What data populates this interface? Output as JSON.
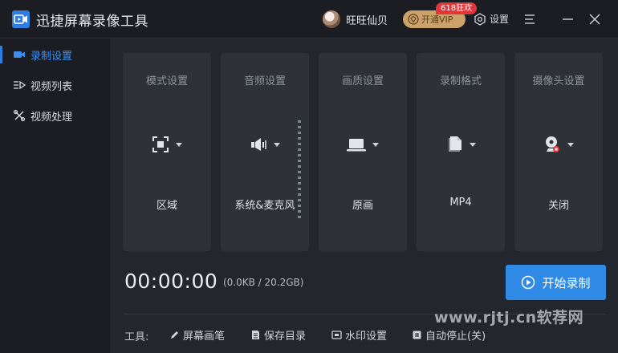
{
  "app": {
    "title": "迅捷屏幕录像工具",
    "logo_icon": "video-camera-icon"
  },
  "header": {
    "username": "旺旺仙贝",
    "vip_label": "开通VIP",
    "promo_badge": "618狂欢",
    "settings_label": "设置"
  },
  "sidebar": {
    "items": [
      {
        "label": "录制设置",
        "icon": "camera-icon",
        "active": true
      },
      {
        "label": "视频列表",
        "icon": "list-icon",
        "active": false
      },
      {
        "label": "视频处理",
        "icon": "tools-icon",
        "active": false
      }
    ]
  },
  "cards": [
    {
      "title": "模式设置",
      "value": "区域",
      "icon": "region-select-icon"
    },
    {
      "title": "音频设置",
      "value": "系统&麦克风",
      "icon": "speaker-icon"
    },
    {
      "title": "画质设置",
      "value": "原画",
      "icon": "laptop-icon"
    },
    {
      "title": "录制格式",
      "value": "MP4",
      "icon": "file-icon"
    },
    {
      "title": "摄像头设置",
      "value": "关闭",
      "icon": "webcam-off-icon"
    }
  ],
  "status": {
    "timer": "00:00:00",
    "size": "(0.0KB / 20.2GB)"
  },
  "record_button": {
    "label": "开始录制"
  },
  "toolbar": {
    "label": "工具:",
    "items": [
      {
        "label": "屏幕画笔",
        "icon": "pen-icon"
      },
      {
        "label": "保存目录",
        "icon": "folder-file-icon"
      },
      {
        "label": "水印设置",
        "icon": "watermark-icon"
      },
      {
        "label": "自动停止(关)",
        "icon": "stop-icon"
      }
    ]
  },
  "watermark": "www.rjtj.cn软荐网",
  "colors": {
    "accent": "#2f8ae6",
    "background": "#23262d",
    "sidebar": "#1b1d22",
    "card": "#2e3138",
    "vip": "#caa26a",
    "promo": "#e2373a"
  }
}
